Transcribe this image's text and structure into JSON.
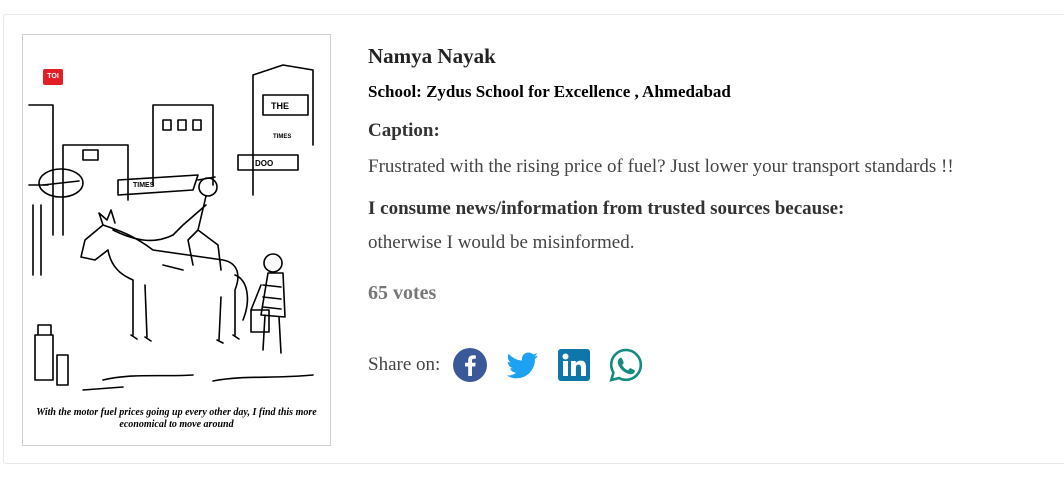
{
  "entry": {
    "name": "Namya Nayak",
    "school": "School: Zydus School for Excellence , Ahmedabad",
    "caption_label": "Caption:",
    "caption_text": "Frustrated with the rising price of fuel? Just lower your transport standards !!",
    "consume_label": "I consume news/information from trusted sources because:",
    "consume_text": "otherwise I would be misinformed.",
    "votes": "65 votes"
  },
  "cartoon": {
    "badge": "TOI",
    "caption": "With the motor fuel prices going up every other day, I find this more economical to move around",
    "sign_texts": [
      "THE",
      "TIMES",
      "TIMES",
      "DOO"
    ]
  },
  "share": {
    "label": "Share on:",
    "icons": [
      {
        "name": "facebook-icon",
        "color": "#3b5998"
      },
      {
        "name": "twitter-icon",
        "color": "#1da1f2"
      },
      {
        "name": "linkedin-icon",
        "color": "#0e76a8"
      },
      {
        "name": "whatsapp-icon",
        "color": "#128c7e"
      }
    ]
  }
}
